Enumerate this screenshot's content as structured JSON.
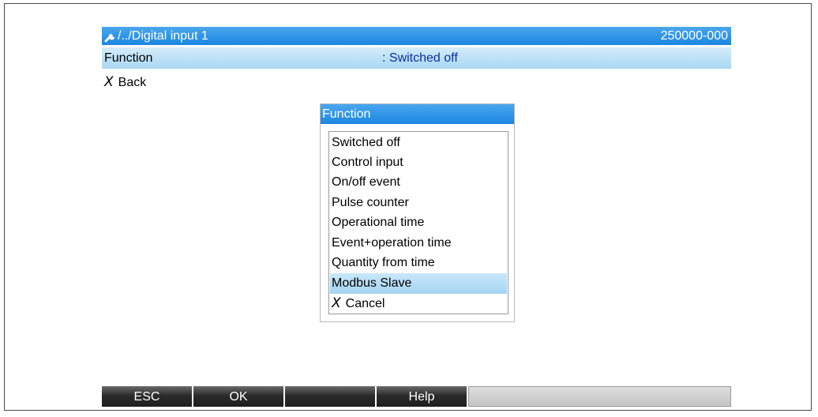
{
  "header": {
    "path": "/../Digital input 1",
    "code": "250000-000",
    "icon": "wrench-icon"
  },
  "parameter": {
    "label": "Function",
    "value": ": Switched off"
  },
  "back": {
    "icon": "x-icon",
    "label": "Back"
  },
  "dialog": {
    "title": "Function",
    "options": [
      {
        "label": "Switched off"
      },
      {
        "label": "Control input"
      },
      {
        "label": "On/off event"
      },
      {
        "label": "Pulse counter"
      },
      {
        "label": "Operational time"
      },
      {
        "label": "Event+operation time"
      },
      {
        "label": "Quantity from time"
      },
      {
        "label": "Modbus Slave",
        "selected": true
      },
      {
        "label": "Cancel",
        "icon": "x-icon"
      }
    ],
    "selected_index": 7
  },
  "softkeys": [
    {
      "label": "ESC"
    },
    {
      "label": "OK"
    },
    {
      "label": ""
    },
    {
      "label": "Help"
    }
  ],
  "colors": {
    "title_bar": "#1b86e0",
    "highlight": "#a9d7f4",
    "value_text": "#0a2ea8"
  }
}
